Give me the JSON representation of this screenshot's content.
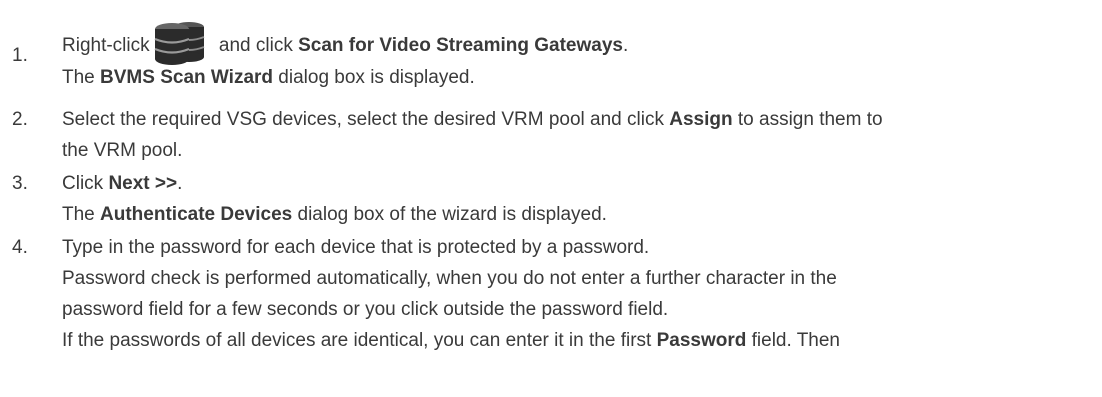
{
  "steps": [
    {
      "number": "1.",
      "lines": [
        {
          "pre": "Right-click",
          "icon": "vsg-server-stack-icon",
          "mid": " and click ",
          "bold": "Scan for Video Streaming Gateways",
          "post": "."
        },
        {
          "pre": "The ",
          "bold": "BVMS Scan Wizard",
          "post": " dialog box is displayed."
        }
      ]
    },
    {
      "number": "2.",
      "lines": [
        {
          "pre": "Select the required VSG devices, select the desired VRM pool and click ",
          "bold": "Assign",
          "post": " to assign them to"
        },
        {
          "pre": "the VRM pool."
        }
      ]
    },
    {
      "number": "3.",
      "lines": [
        {
          "pre": "Click ",
          "bold": "Next >>",
          "post": "."
        },
        {
          "pre": "The ",
          "bold": "Authenticate Devices",
          "post": " dialog box of the wizard is displayed."
        }
      ]
    },
    {
      "number": "4.",
      "lines": [
        {
          "pre": "Type in the password for each device that is protected by a password."
        },
        {
          "pre": "Password check is performed automatically, when you do not enter a further character in the"
        },
        {
          "pre": "password field for a few seconds or you click outside the password field."
        },
        {
          "pre": "If the passwords of all devices are identical, you can enter it in the first ",
          "bold": "Password",
          "post": " field. Then"
        }
      ]
    }
  ],
  "colors": {
    "text": "#3a3a3a",
    "icon_dark": "#2b2b2b",
    "icon_mid": "#555555",
    "icon_light": "#8a8a8a"
  }
}
